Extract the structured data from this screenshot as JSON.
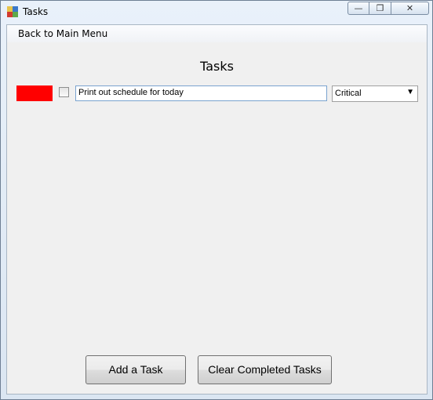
{
  "window": {
    "title": "Tasks",
    "min_glyph": "—",
    "max_glyph": "❐",
    "close_glyph": "✕"
  },
  "menu": {
    "back_label": "Back to Main Menu"
  },
  "heading": "Tasks",
  "tasks": [
    {
      "color": "#ff0000",
      "checked": false,
      "text": "Print out schedule for today",
      "priority": "Critical"
    }
  ],
  "buttons": {
    "add_label": "Add a Task",
    "clear_label": "Clear Completed Tasks"
  }
}
